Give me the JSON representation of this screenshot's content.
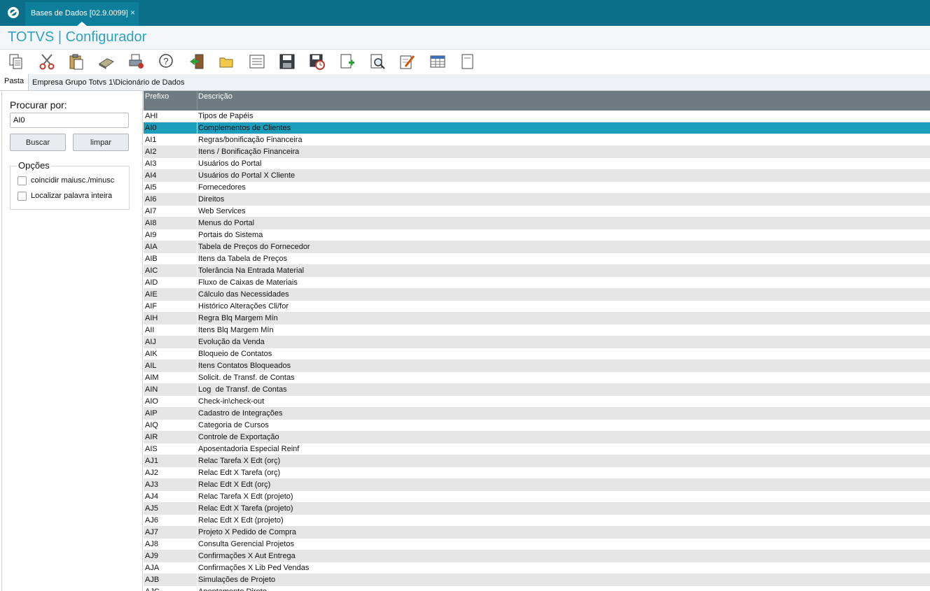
{
  "window": {
    "tab_label": "Bases de Dados [02.9.0099]",
    "tab_close": "×"
  },
  "app": {
    "title": "TOTVS | Configurador"
  },
  "toolbar": {
    "icons": [
      "copy-icon",
      "cut-icon",
      "paste-icon",
      "book-icon",
      "print-icon",
      "help-icon",
      "exit-icon",
      "folder-icon",
      "list-icon",
      "save-icon",
      "save-schedule-icon",
      "add-file-icon",
      "preview-icon",
      "edit-icon",
      "table-icon",
      "document-icon"
    ]
  },
  "pathbar": {
    "pasta_label": "Pasta",
    "path": "Empresa Grupo Totvs 1\\Dicionário de Dados"
  },
  "search": {
    "title": "Procurar por:",
    "value": "AI0",
    "buscar_label": "Buscar",
    "limpar_label": "limpar",
    "options_title": "Opções",
    "option_case": "coincidir maiusc./minusc",
    "option_whole": "Localizar palavra inteira"
  },
  "grid": {
    "headers": [
      "Prefixo",
      "Descrição"
    ],
    "selected_index": 1,
    "rows": [
      [
        "AHI",
        "Tipos de Papéis"
      ],
      [
        "AI0",
        "Complementos de Clientes"
      ],
      [
        "AI1",
        "Regras/bonificação Financeira"
      ],
      [
        "AI2",
        "Itens / Bonificação Financeira"
      ],
      [
        "AI3",
        "Usuários do Portal"
      ],
      [
        "AI4",
        "Usuários do Portal X Cliente"
      ],
      [
        "AI5",
        "Fornecedores"
      ],
      [
        "AI6",
        "Direitos"
      ],
      [
        "AI7",
        "Web Services"
      ],
      [
        "AI8",
        "Menus do Portal"
      ],
      [
        "AI9",
        "Portais do Sistema"
      ],
      [
        "AIA",
        "Tabela de Preços do Fornecedor"
      ],
      [
        "AIB",
        "Itens da Tabela de Preços"
      ],
      [
        "AIC",
        "Tolerância Na Entrada Material"
      ],
      [
        "AID",
        "Fluxo de Caixas de Materiais"
      ],
      [
        "AIE",
        "Cálculo das Necessidades"
      ],
      [
        "AIF",
        "Histórico Alterações Cli/for"
      ],
      [
        "AIH",
        "Regra Blq Margem Mín"
      ],
      [
        "AII",
        "Itens Blq Margem Mín"
      ],
      [
        "AIJ",
        "Evolução da Venda"
      ],
      [
        "AIK",
        "Bloqueio de Contatos"
      ],
      [
        "AIL",
        "Itens Contatos Bloqueados"
      ],
      [
        "AIM",
        "Solicit. de Transf. de Contas"
      ],
      [
        "AIN",
        "Log  de Transf. de Contas"
      ],
      [
        "AIO",
        "Check-in\\check-out"
      ],
      [
        "AIP",
        "Cadastro de Integrações"
      ],
      [
        "AIQ",
        "Categoria de Cursos"
      ],
      [
        "AIR",
        "Controle de Exportação"
      ],
      [
        "AIS",
        "Aposentadoria Especial Reinf"
      ],
      [
        "AJ1",
        "Relac Tarefa X Edt (orç)"
      ],
      [
        "AJ2",
        "Relac Edt X Tarefa (orç)"
      ],
      [
        "AJ3",
        "Relac Edt X Edt (orç)"
      ],
      [
        "AJ4",
        "Relac Tarefa X Edt (projeto)"
      ],
      [
        "AJ5",
        "Relac Edt X Tarefa (projeto)"
      ],
      [
        "AJ6",
        "Relac Edt X Edt (projeto)"
      ],
      [
        "AJ7",
        "Projeto X Pedido de Compra"
      ],
      [
        "AJ8",
        "Consulta Gerencial Projetos"
      ],
      [
        "AJ9",
        "Confirmações X Aut Entrega"
      ],
      [
        "AJA",
        "Confirmações X Lib Ped Vendas"
      ],
      [
        "AJB",
        "Simulações de Projeto"
      ],
      [
        "AJC",
        "Apontamento Direto"
      ]
    ]
  }
}
